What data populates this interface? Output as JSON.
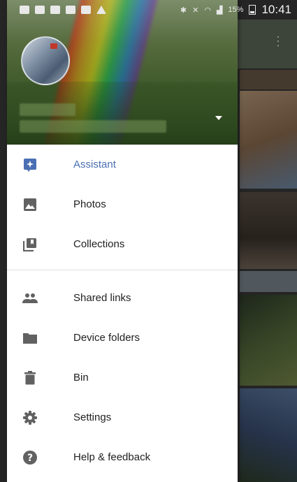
{
  "status_bar": {
    "battery_percent": "15%",
    "time": "10:41"
  },
  "drawer": {
    "primary_items": [
      {
        "label": "Assistant",
        "icon": "assistant-icon"
      },
      {
        "label": "Photos",
        "icon": "photos-icon"
      },
      {
        "label": "Collections",
        "icon": "collections-icon"
      }
    ],
    "secondary_items": [
      {
        "label": "Shared links",
        "icon": "people-icon"
      },
      {
        "label": "Device folders",
        "icon": "folder-icon"
      },
      {
        "label": "Bin",
        "icon": "bin-icon"
      },
      {
        "label": "Settings",
        "icon": "gear-icon"
      },
      {
        "label": "Help & feedback",
        "icon": "help-icon"
      }
    ]
  },
  "colors": {
    "active_accent": "#4a6fb3",
    "icon_gray": "#616161",
    "drawer_bg": "#ffffff"
  }
}
